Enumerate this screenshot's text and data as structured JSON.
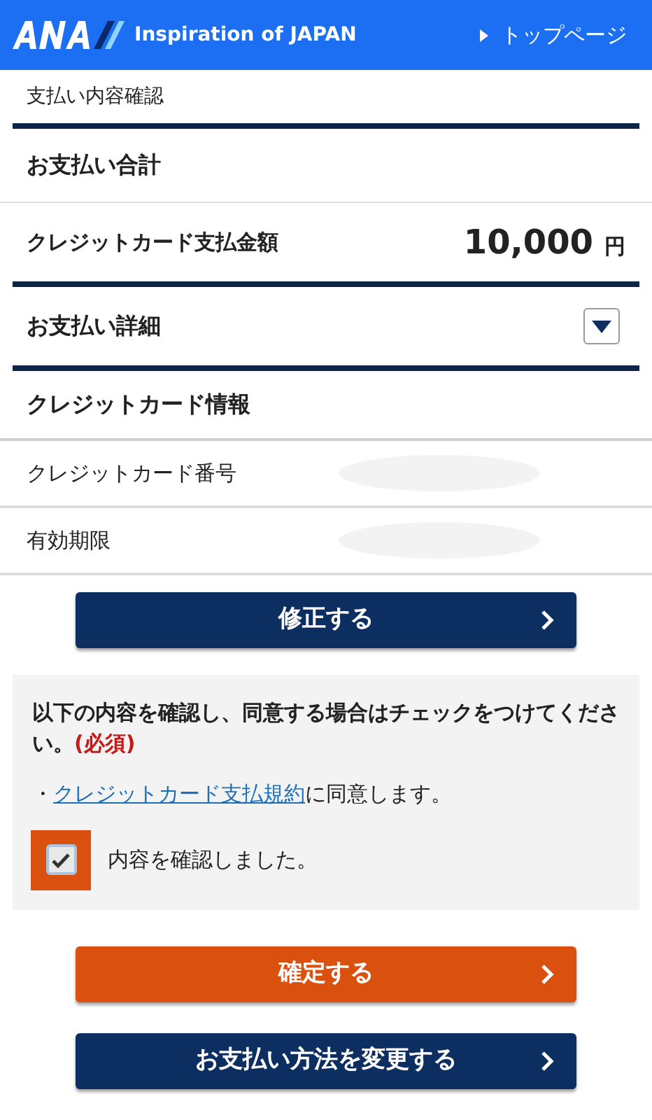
{
  "header": {
    "tagline": "Inspiration of JAPAN",
    "top_link": "トップページ"
  },
  "breadcrumb": "支払い内容確認",
  "total": {
    "heading": "お支払い合計",
    "label": "クレジットカード支払金額",
    "amount": "10,000",
    "unit": "円"
  },
  "details": {
    "heading": "お支払い詳細",
    "expanded": false
  },
  "card": {
    "heading": "クレジットカード情報",
    "rows": [
      {
        "label": "クレジットカード番号"
      },
      {
        "label": "有効期限"
      }
    ]
  },
  "edit_button": "修正する",
  "agreement": {
    "text": "以下の内容を確認し、同意する場合はチェックをつけてください。",
    "required": "(必須)",
    "bullet": "・",
    "link": "クレジットカード支払規約",
    "link_suffix": "に同意します。",
    "checkbox_label": "内容を確認しました。",
    "checked": true
  },
  "buttons": [
    {
      "label": "確定する",
      "kind": "primary"
    },
    {
      "label": "お支払い方法を変更する",
      "kind": "secondary"
    }
  ]
}
